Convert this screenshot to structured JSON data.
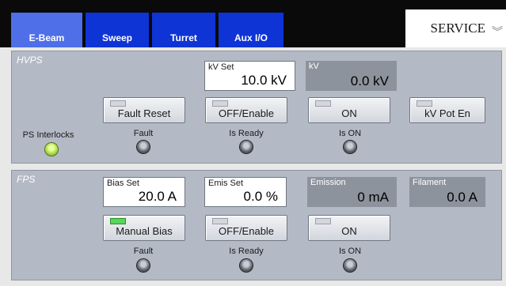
{
  "tabs": [
    {
      "label": "E-Beam",
      "active": true
    },
    {
      "label": "Sweep",
      "active": false
    },
    {
      "label": "Turret",
      "active": false
    },
    {
      "label": "Aux I/O",
      "active": false
    }
  ],
  "service": {
    "label": "SERVICE"
  },
  "hvps": {
    "title": "HVPS",
    "kv_set": {
      "label": "kV Set",
      "value": "10.0 kV"
    },
    "kv": {
      "label": "kV",
      "value": "0.0 kV"
    },
    "buttons": {
      "fault_reset": "Fault Reset",
      "off_enable": "OFF/Enable",
      "on": "ON",
      "kv_pot_en": "kV Pot En"
    },
    "status": {
      "ps_interlocks": "PS Interlocks",
      "fault": "Fault",
      "is_ready": "Is Ready",
      "is_on": "Is ON"
    }
  },
  "fps": {
    "title": "FPS",
    "bias_set": {
      "label": "Bias Set",
      "value": "20.0 A"
    },
    "emis_set": {
      "label": "Emis Set",
      "value": "0.0 %"
    },
    "emission": {
      "label": "Emission",
      "value": "0 mA"
    },
    "filament": {
      "label": "Filament",
      "value": "0.0 A"
    },
    "buttons": {
      "manual_bias": "Manual Bias",
      "off_enable": "OFF/Enable",
      "on": "ON"
    },
    "status": {
      "fault": "Fault",
      "is_ready": "Is Ready",
      "is_on": "Is ON"
    }
  },
  "colors": {
    "tab_blue": "#0e34d6",
    "tab_active": "#4f6fe8",
    "panel": "#b3bac5",
    "readout": "#8d939c",
    "led_green": "#57d65a",
    "light_on": "#a7d742"
  }
}
